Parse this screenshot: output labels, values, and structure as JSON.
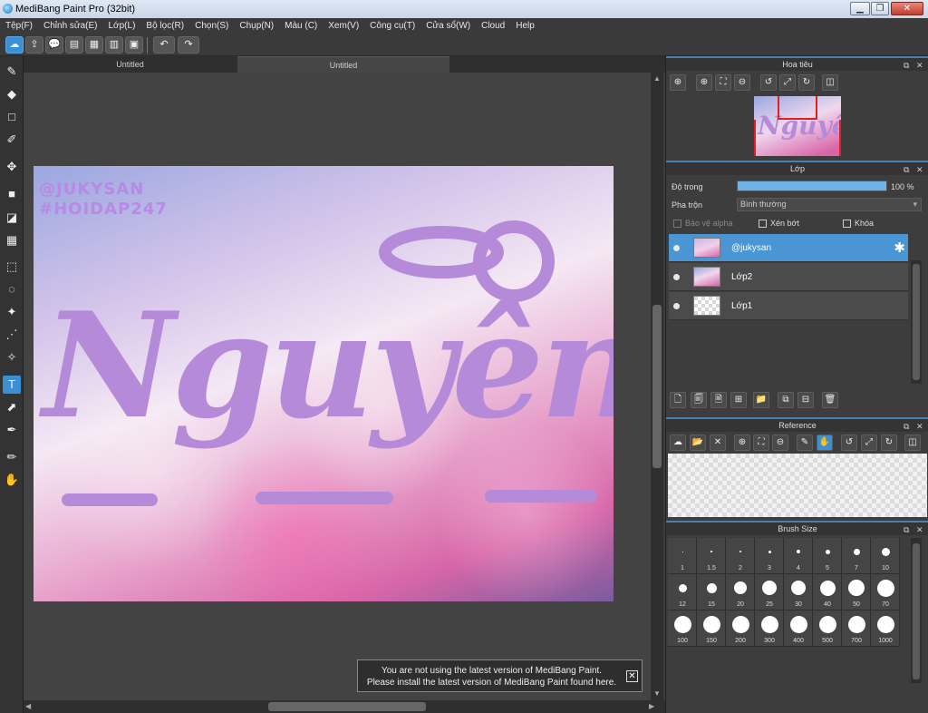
{
  "window": {
    "title": "MediBang Paint Pro (32bit)",
    "minimize": "▁",
    "maximize": "❐",
    "close": "✕"
  },
  "menu": [
    "Tệp(F)",
    "Chỉnh sửa(E)",
    "Lớp(L)",
    "Bộ lọc(R)",
    "Chọn(S)",
    "Chụp(N)",
    "Màu (C)",
    "Xem(V)",
    "Công cụ(T)",
    "Cửa sổ(W)",
    "Cloud",
    "Help"
  ],
  "toolbar": {
    "icons": [
      "☁",
      "⇪",
      "💬",
      "▤",
      "▦",
      "▥",
      "▣"
    ],
    "undo": "↶",
    "redo": "↷"
  },
  "tools": [
    "✎",
    "◆",
    "□",
    "✐",
    "✥",
    "■",
    "◪",
    "▦",
    "⬚",
    "◌",
    "✦",
    "⋰",
    "✧",
    "T",
    "⬈",
    "✒",
    "✏",
    "✋"
  ],
  "tabs": [
    "Untitled",
    "Untitled"
  ],
  "artwork": {
    "handle": "@JUKYSAN",
    "hashtag": "#HOIDAP247",
    "name": "Nguyên",
    "colors": {
      "lettering": "#b58ad8"
    }
  },
  "notice": {
    "line1": "You are not using the latest version of MediBang Paint.",
    "line2": "Please install the latest version of MediBang Paint found here.",
    "close": "✕"
  },
  "navigator": {
    "title": "Hoa tiêu",
    "thumb_text": "Nguyên",
    "buttons": [
      "⊕",
      "⊕",
      "⛶",
      "⊖",
      "↺",
      "⤢",
      "↻",
      "◫"
    ]
  },
  "layers": {
    "title": "Lớp",
    "opacity_label": "Độ trong",
    "opacity_value": "100 %",
    "opacity_percent": 100,
    "blend_label": "Pha trộn",
    "blend_value": "Bình thường",
    "protect_alpha": "Bảo vệ alpha",
    "clipping": "Xén bớt",
    "lock": "Khóa",
    "items": [
      {
        "name": "@jukysan",
        "selected": true
      },
      {
        "name": "Lớp2",
        "selected": false
      },
      {
        "name": "Lớp1",
        "selected": false
      }
    ],
    "footer_buttons": [
      "🗋",
      "🗐",
      "🗎",
      "⊞",
      "📁",
      "⧉",
      "⊟",
      "🗑"
    ]
  },
  "reference": {
    "title": "Reference",
    "buttons": [
      "☁",
      "📂",
      "✕",
      "⊕",
      "⛶",
      "⊖",
      "✎",
      "✋",
      "↺",
      "⤢",
      "↻",
      "◫"
    ]
  },
  "brush_size": {
    "title": "Brush Size",
    "sizes": [
      "1",
      "1.5",
      "2",
      "3",
      "4",
      "5",
      "7",
      "10",
      "12",
      "15",
      "20",
      "25",
      "30",
      "40",
      "50",
      "70",
      "100",
      "150",
      "200",
      "300",
      "400",
      "500",
      "700",
      "1000"
    ]
  },
  "panel_icons": {
    "float": "⧉",
    "close": "✕"
  },
  "colors": {
    "accent": "#3b8fd4",
    "panel": "#3d3d3d"
  }
}
